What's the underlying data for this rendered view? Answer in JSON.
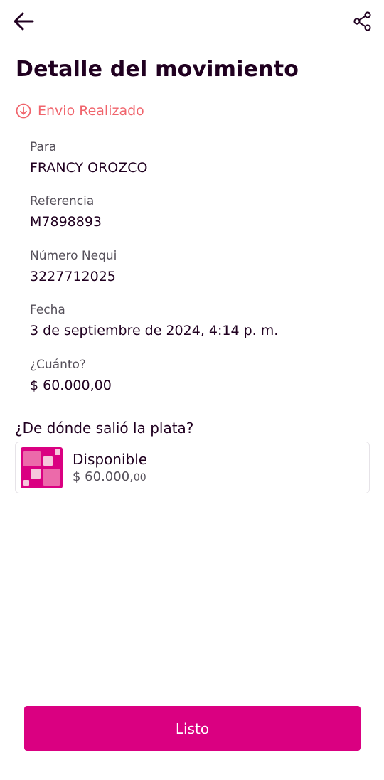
{
  "header": {
    "back_icon": "arrow-left-icon",
    "share_icon": "share-icon",
    "title": "Detalle del movimiento"
  },
  "status": {
    "icon": "arrow-down-circle-icon",
    "text": "Envio Realizado",
    "color": "#f0646c"
  },
  "fields": [
    {
      "label": "Para",
      "value": "FRANCY OROZCO"
    },
    {
      "label": "Referencia",
      "value": "M7898893"
    },
    {
      "label": "Número Nequi",
      "value": "3227712025"
    },
    {
      "label": "Fecha",
      "value": "3 de septiembre de 2024, 4:14 p. m."
    },
    {
      "label": "¿Cuánto?",
      "value": "$ 60.000,00"
    }
  ],
  "source": {
    "section_title": "¿De dónde salió la plata?",
    "account_name": "Disponible",
    "amount_main": "$ 60.000,",
    "amount_cents": "00",
    "logo_icon": "nequi-squares-icon"
  },
  "actions": {
    "done_label": "Listo"
  },
  "colors": {
    "brand": "#da0081",
    "text_dark": "#200020",
    "status": "#f0646c"
  }
}
